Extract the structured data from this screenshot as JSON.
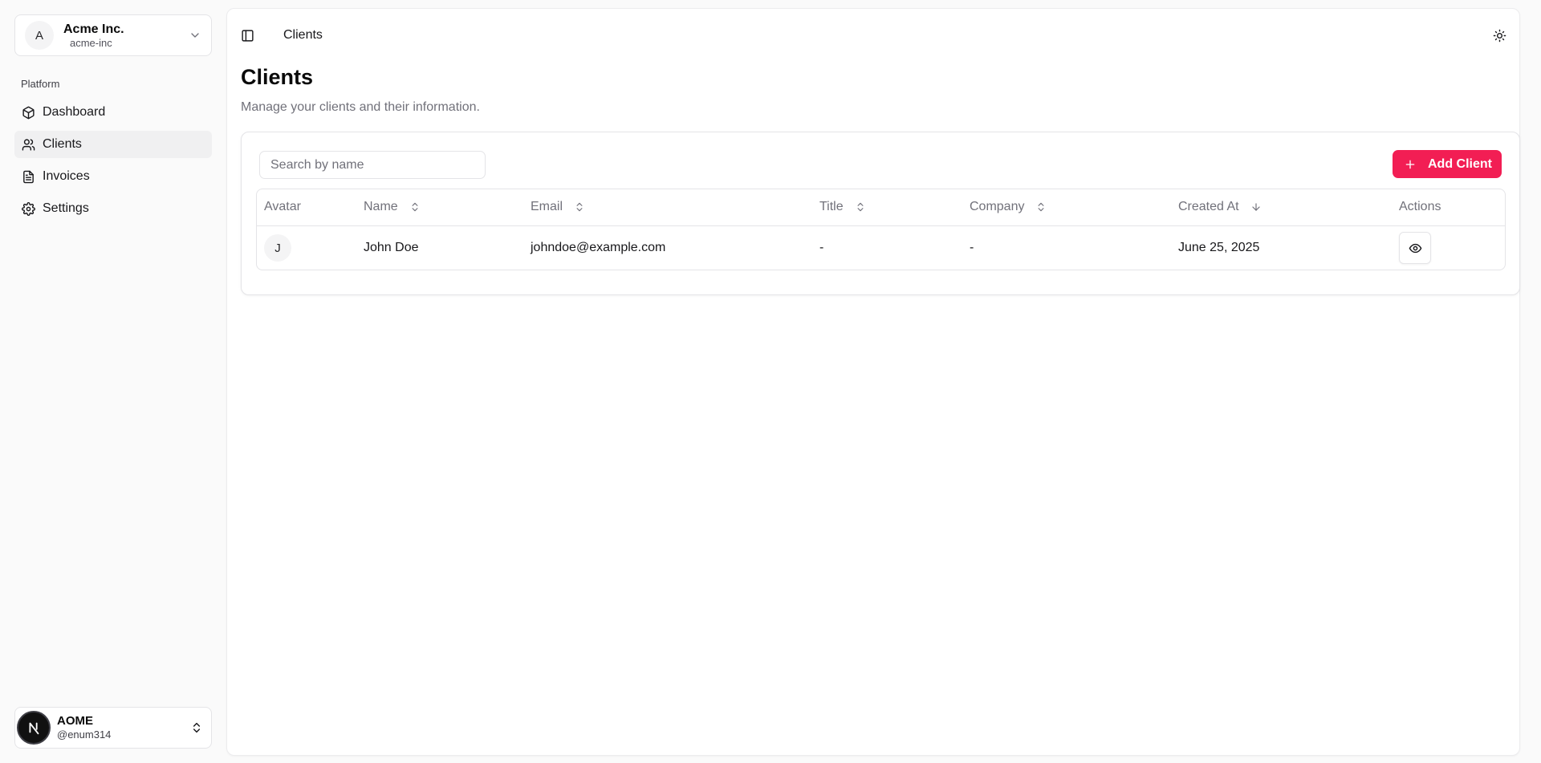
{
  "org": {
    "initial": "A",
    "name": "Acme Inc.",
    "slug": "acme-inc"
  },
  "sidebar": {
    "group_label": "Platform",
    "items": [
      {
        "label": "Dashboard",
        "icon": "box-icon",
        "active": false
      },
      {
        "label": "Clients",
        "icon": "users-icon",
        "active": true
      },
      {
        "label": "Invoices",
        "icon": "file-text-icon",
        "active": false
      },
      {
        "label": "Settings",
        "icon": "gear-icon",
        "active": false
      }
    ]
  },
  "user": {
    "name": "AOME",
    "handle": "@enum314",
    "avatar_letter": "N"
  },
  "header": {
    "breadcrumb": "Clients"
  },
  "page": {
    "title": "Clients",
    "subtitle": "Manage your clients and their information."
  },
  "toolbar": {
    "search_placeholder": "Search by name",
    "search_value": "",
    "add_label": "Add Client"
  },
  "table": {
    "columns": [
      {
        "label": "Avatar",
        "sort": "none"
      },
      {
        "label": "Name",
        "sort": "unsorted"
      },
      {
        "label": "Email",
        "sort": "unsorted"
      },
      {
        "label": "Title",
        "sort": "unsorted"
      },
      {
        "label": "Company",
        "sort": "unsorted"
      },
      {
        "label": "Created At",
        "sort": "desc"
      },
      {
        "label": "Actions",
        "sort": "none"
      }
    ],
    "rows": [
      {
        "avatar": "J",
        "name": "John Doe",
        "email": "johndoe@example.com",
        "title": "-",
        "company": "-",
        "created_at": "June 25, 2025"
      }
    ]
  },
  "colors": {
    "accent": "#f21e54",
    "active_nav_bg": "#f0f0f1"
  }
}
